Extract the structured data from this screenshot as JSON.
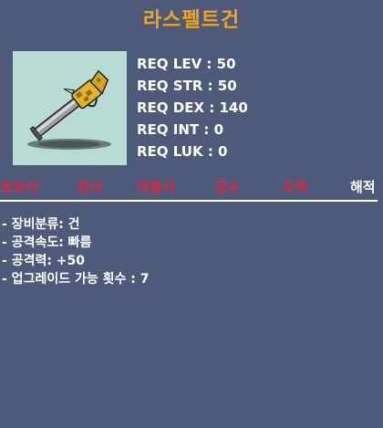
{
  "item": {
    "name": "라스펠트건",
    "icon": "pistol-icon"
  },
  "requirements": [
    "REQ LEV : 50",
    "REQ STR : 50",
    "REQ DEX : 140",
    "REQ INT : 0",
    "REQ LUK : 0"
  ],
  "jobs": [
    {
      "label": "초보자",
      "state": "unavailable"
    },
    {
      "label": "전사",
      "state": "unavailable"
    },
    {
      "label": "마법사",
      "state": "unavailable"
    },
    {
      "label": "궁수",
      "state": "unavailable"
    },
    {
      "label": "도적",
      "state": "unavailable"
    },
    {
      "label": "해적",
      "state": "available"
    }
  ],
  "stats": [
    "- 장비분류: 건",
    "- 공격속도: 빠름",
    "- 공격력: +50",
    "- 업그레이드 가능 횟수 : 7"
  ],
  "colors": {
    "background": "#4d5a7a",
    "title": "#f0a51c",
    "job_unavailable": "#e8223a",
    "job_available": "#ffffff",
    "icon_background": "#b8dcd5"
  }
}
